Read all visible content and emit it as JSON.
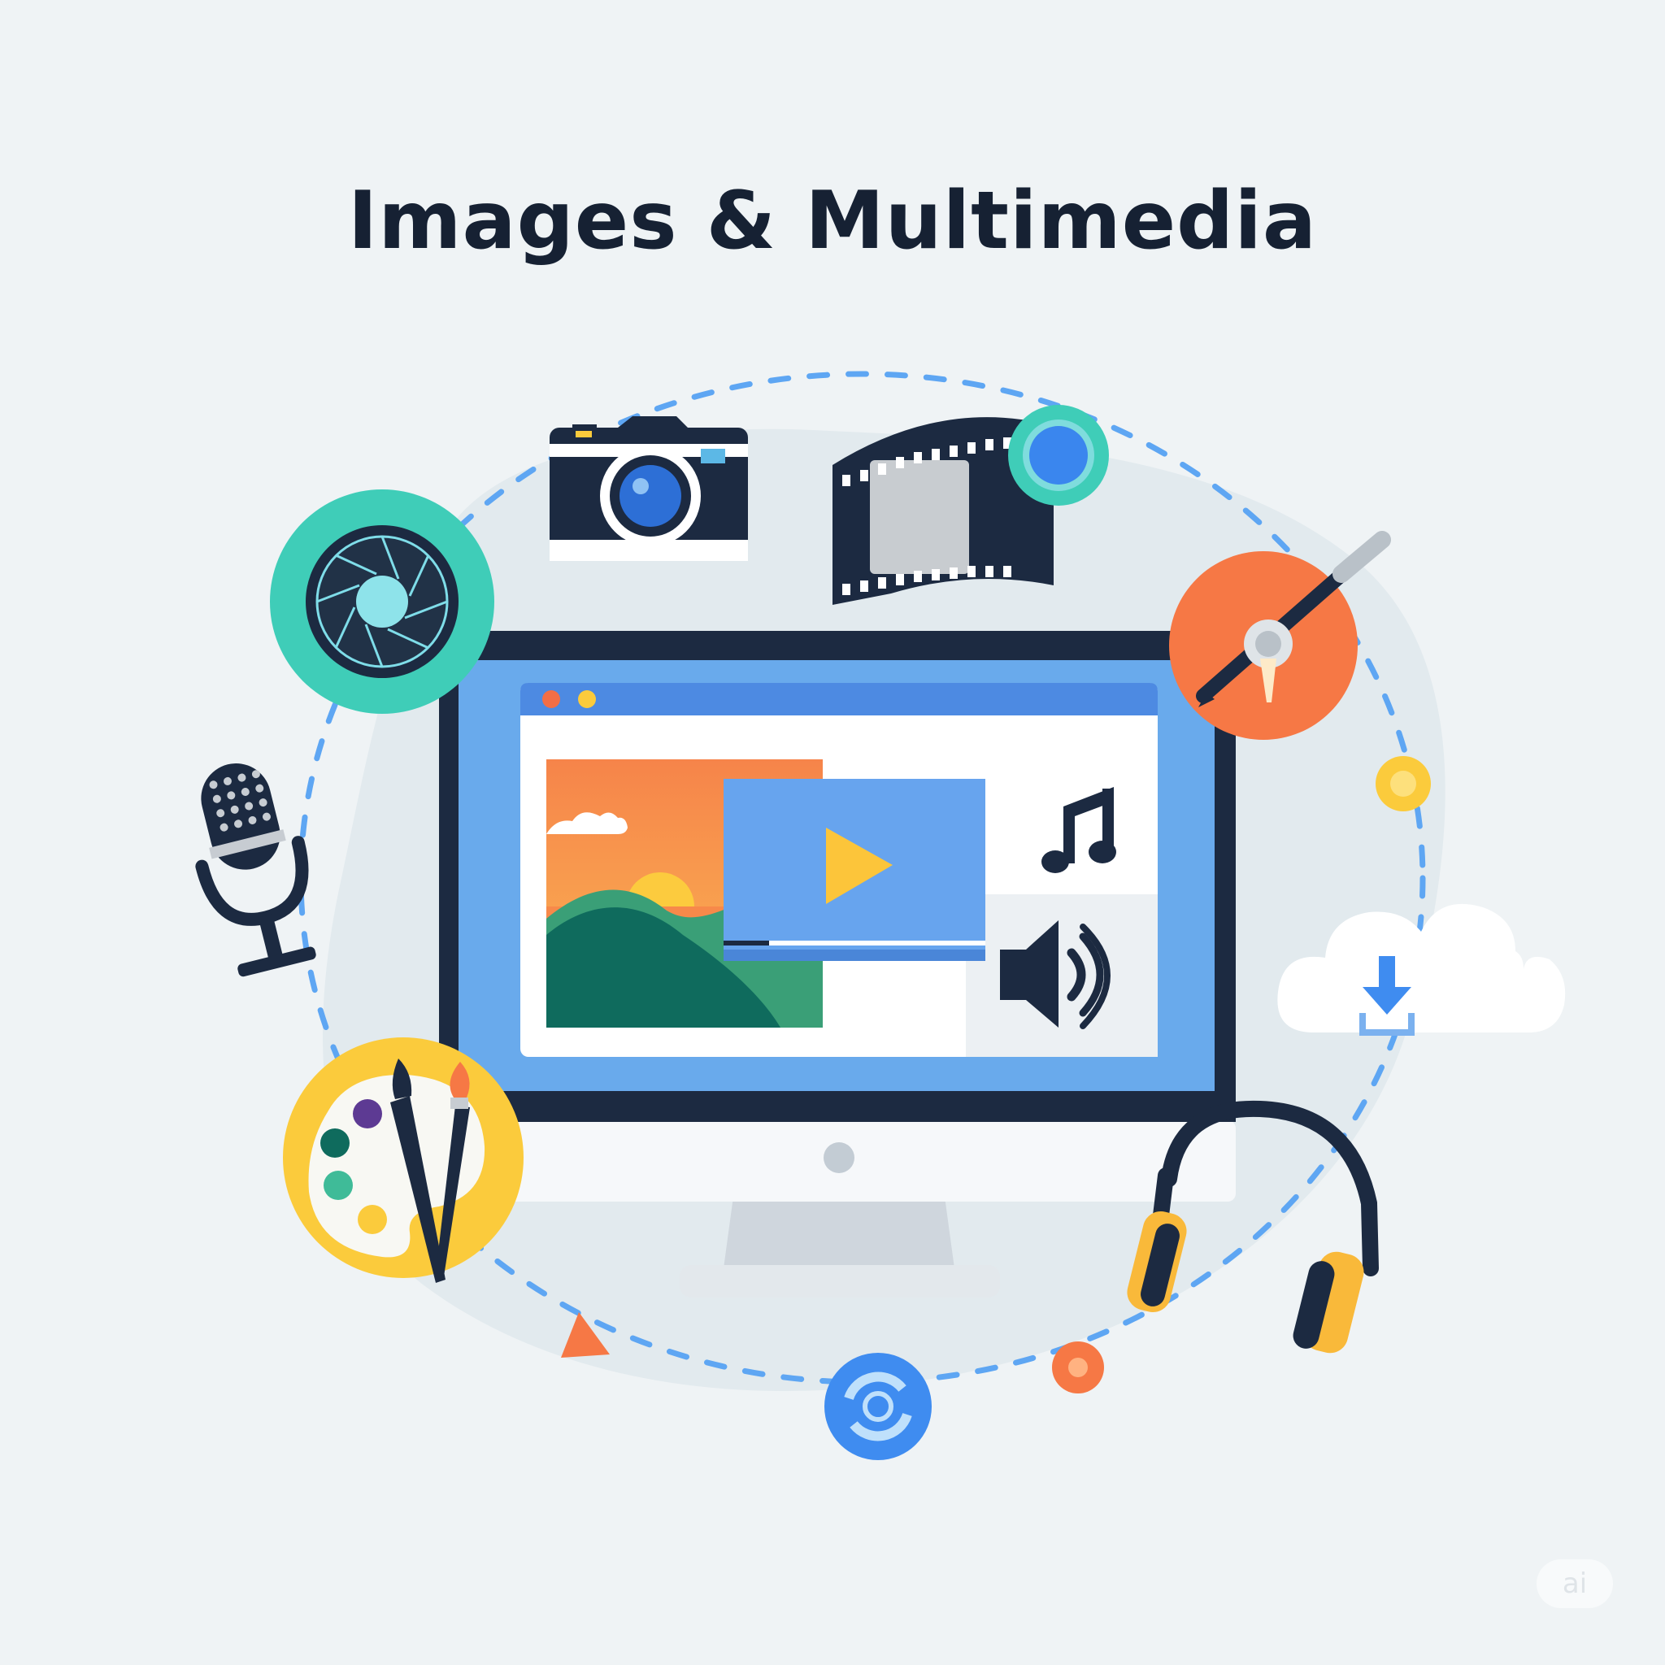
{
  "title": "Images & Multimedia",
  "watermark": "ai",
  "colors": {
    "background": "#eff3f5",
    "navy": "#1c2a41",
    "blue": "#3f8cf0",
    "teal": "#3fcdb8",
    "orange": "#f67845",
    "yellow": "#fbcb3c",
    "green": "#0f6b5d"
  },
  "icons": [
    "aperture-icon",
    "camera-icon",
    "film-strip-icon",
    "pen-tool-icon",
    "microphone-icon",
    "palette-icon",
    "cloud-download-icon",
    "headphones-icon",
    "monitor-icon",
    "landscape-image-icon",
    "video-play-icon",
    "music-note-icon",
    "speaker-icon",
    "sync-icon"
  ]
}
